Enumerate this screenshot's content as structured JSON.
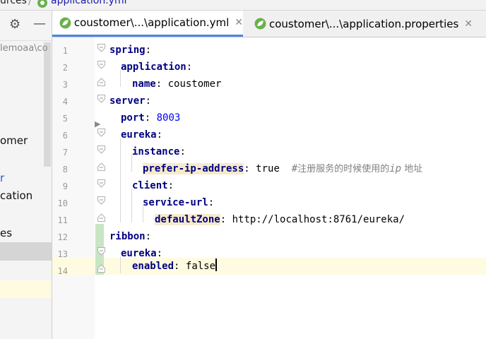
{
  "breadcrumb": {
    "parent": "urces",
    "separator": "/",
    "file": "application.yml"
  },
  "toolwindow": {
    "settings_icon": "gear-icon",
    "collapse_icon": "minus-icon",
    "items": [
      "lemoaa\\co",
      "omer",
      "r",
      "cation",
      "es"
    ]
  },
  "tabs": [
    {
      "label": "coustomer\\...\\application.yml",
      "active": true
    },
    {
      "label": "coustomer\\...\\application.properties",
      "active": false
    }
  ],
  "editor": {
    "line_numbers": [
      "1",
      "2",
      "3",
      "4",
      "5",
      "6",
      "7",
      "8",
      "9",
      "10",
      "11",
      "12",
      "13",
      "14"
    ],
    "lines": [
      {
        "key": "spring",
        "sep": ":"
      },
      {
        "key": "application",
        "sep": ":"
      },
      {
        "key": "name",
        "sep": ":",
        "value": "coustomer"
      },
      {
        "key": "server",
        "sep": ":"
      },
      {
        "key": "port",
        "sep": ":",
        "value": "8003"
      },
      {
        "key": "eureka",
        "sep": ":"
      },
      {
        "key": "instance",
        "sep": ":"
      },
      {
        "key": "prefer-ip-address",
        "sep": ":",
        "value": "true",
        "comment_hash": "#",
        "comment_a": "注册服务的时候使用的",
        "comment_b": "ip",
        "comment_c": " 地址"
      },
      {
        "key": "client",
        "sep": ":"
      },
      {
        "key": "service-url",
        "sep": ":"
      },
      {
        "key": "defaultZone",
        "sep": ":",
        "value": "http://localhost:8761/eureka/"
      },
      {
        "key": "ribbon",
        "sep": ":"
      },
      {
        "key": "eureka",
        "sep": ":"
      },
      {
        "key": "enabled",
        "sep": ":",
        "value": "false"
      }
    ]
  }
}
